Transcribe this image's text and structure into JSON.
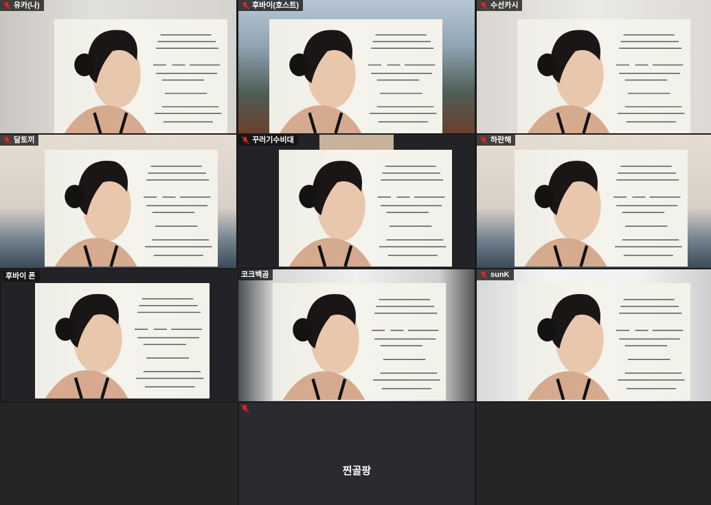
{
  "meeting": {
    "participants": [
      {
        "name": "유카(나)",
        "background": "room",
        "muted": true,
        "has_video": true
      },
      {
        "name": "후바이(호스트)",
        "background": "mountain",
        "muted": true,
        "has_video": true
      },
      {
        "name": "수선카시",
        "background": "room2",
        "muted": true,
        "has_video": true
      },
      {
        "name": "달토끼",
        "background": "city",
        "muted": true,
        "has_video": true
      },
      {
        "name": "꾸러기수비대",
        "background": "dark",
        "muted": true,
        "has_video": true
      },
      {
        "name": "하란해",
        "background": "city",
        "muted": true,
        "has_video": true
      },
      {
        "name": "후바이 폰",
        "background": "dark",
        "muted": false,
        "has_video": true,
        "active_speaker": true
      },
      {
        "name": "코크백곰",
        "background": "gym",
        "muted": false,
        "has_video": true
      },
      {
        "name": "sunK",
        "background": "white",
        "muted": true,
        "has_video": true
      },
      {
        "name": "찐골팡",
        "background": "dark",
        "muted": true,
        "has_video": false
      }
    ]
  },
  "colors": {
    "active_speaker_border": "#1fb89a",
    "muted_icon": "#e02828",
    "tile_bg": "#2a2a2e"
  },
  "icons": {
    "muted": "mic-muted-icon"
  }
}
